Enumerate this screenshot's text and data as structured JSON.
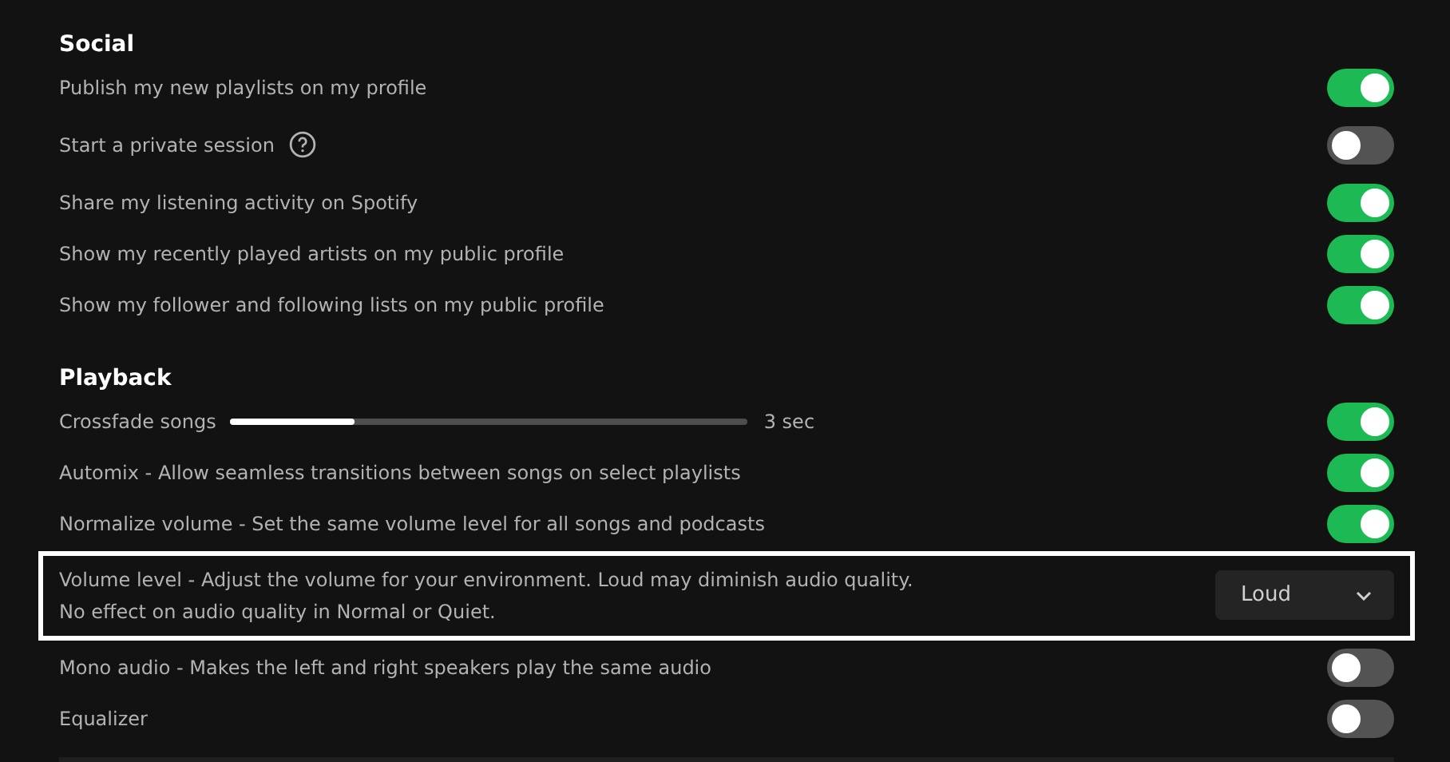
{
  "sections": [
    {
      "title": "Social",
      "rows": [
        {
          "kind": "toggle",
          "label": "Publish my new playlists on my profile",
          "on": true,
          "focused": false
        },
        {
          "kind": "toggle",
          "label": "Start a private session",
          "help": true,
          "on": false,
          "focused": false
        },
        {
          "kind": "toggle",
          "label": "Share my listening activity on Spotify",
          "on": true,
          "focused": false
        },
        {
          "kind": "toggle",
          "label": "Show my recently played artists on my public profile",
          "on": true,
          "focused": false
        },
        {
          "kind": "toggle",
          "label": "Show my follower and following lists on my public profile",
          "on": true,
          "focused": false
        }
      ]
    },
    {
      "title": "Playback",
      "rows": [
        {
          "kind": "slider",
          "label": "Crossfade songs",
          "level": 0.24,
          "reading": "3 sec",
          "on": true,
          "focused": false
        },
        {
          "kind": "toggle",
          "label": "Automix - Allow seamless transitions between songs on select playlists",
          "on": true,
          "focused": false
        },
        {
          "kind": "toggle",
          "label": "Normalize volume - Set the same volume level for all songs and podcasts",
          "on": true,
          "focused": false
        },
        {
          "kind": "select",
          "label": "Volume level - Adjust the volume for your environment. Loud may diminish audio quality. No effect on audio quality in Normal or Quiet.",
          "value": "Loud",
          "focused": true
        },
        {
          "kind": "toggle",
          "label": "Mono audio - Makes the left and right speakers play the same audio",
          "on": false,
          "focused": false
        },
        {
          "kind": "toggle",
          "label": "Equalizer",
          "on": false,
          "focused": false
        }
      ]
    }
  ],
  "equalizer_panel": {
    "kind": "panel"
  }
}
